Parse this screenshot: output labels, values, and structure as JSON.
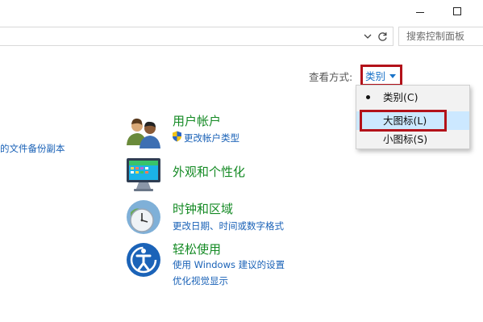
{
  "window": {
    "controls": [
      "minimize-icon",
      "maximize-icon"
    ]
  },
  "address_bar": {
    "dropdown_icon": "chevron-down-icon",
    "refresh_icon": "refresh-icon"
  },
  "search": {
    "placeholder": "搜索控制面板"
  },
  "view_by": {
    "label": "查看方式:",
    "value": "类别",
    "menu": [
      {
        "label": "类别(C)",
        "selected": true
      },
      {
        "label": "大图标(L)",
        "hovered": true
      },
      {
        "label": "小图标(S)"
      }
    ]
  },
  "left_partial_link": "的文件备份副本",
  "categories": [
    {
      "icon": "users-icon",
      "title": "用户帐户",
      "links": [
        {
          "icon": "uac-shield-icon",
          "label": "更改帐户类型"
        }
      ]
    },
    {
      "icon": "appearance-icon",
      "title": "外观和个性化",
      "links": []
    },
    {
      "icon": "clock-globe-icon",
      "title": "时钟和区域",
      "links": [
        {
          "label": "更改日期、时间或数字格式"
        }
      ]
    },
    {
      "icon": "ease-of-access-icon",
      "title": "轻松使用",
      "links": [
        {
          "label": "使用 Windows 建议的设置"
        },
        {
          "label": "优化视觉显示"
        }
      ]
    }
  ],
  "colors": {
    "link_blue": "#1a62b7",
    "category_green": "#148a24",
    "annotation_red": "#b3121a",
    "menu_hover": "#cce8ff"
  }
}
